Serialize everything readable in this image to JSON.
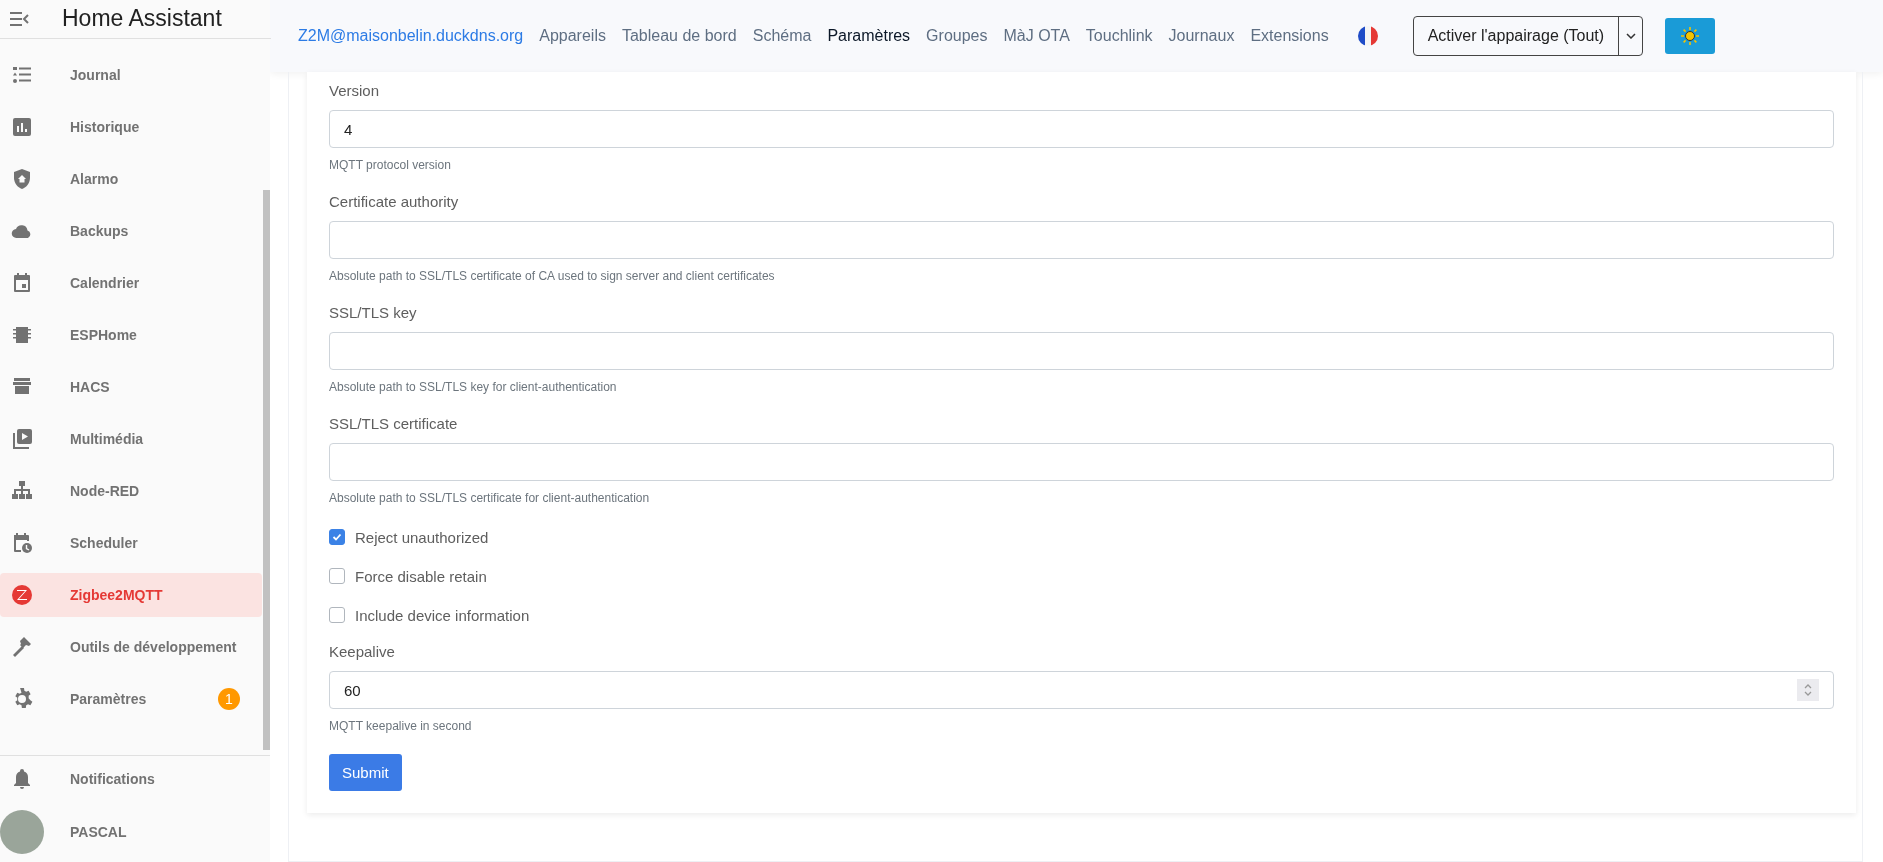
{
  "sidebar": {
    "title": "Home Assistant",
    "items": [
      {
        "label": "Journal",
        "selected": false
      },
      {
        "label": "Historique",
        "selected": false
      },
      {
        "label": "Alarmo",
        "selected": false
      },
      {
        "label": "Backups",
        "selected": false
      },
      {
        "label": "Calendrier",
        "selected": false
      },
      {
        "label": "ESPHome",
        "selected": false
      },
      {
        "label": "HACS",
        "selected": false
      },
      {
        "label": "Multimédia",
        "selected": false
      },
      {
        "label": "Node-RED",
        "selected": false
      },
      {
        "label": "Scheduler",
        "selected": false
      },
      {
        "label": "Zigbee2MQTT",
        "selected": true
      },
      {
        "label": "Outils de développement",
        "selected": false
      },
      {
        "label": "Paramètres",
        "selected": false,
        "badge": "1"
      }
    ],
    "footer": [
      {
        "label": "Notifications",
        "kind": "notifications"
      },
      {
        "label": "PASCAL",
        "kind": "user"
      }
    ]
  },
  "navbar": {
    "brand": "Z2M@maisonbelin.duckdns.org",
    "links": [
      {
        "label": "Appareils",
        "selected": false
      },
      {
        "label": "Tableau de bord",
        "selected": false
      },
      {
        "label": "Schéma",
        "selected": false
      },
      {
        "label": "Paramètres",
        "selected": true
      },
      {
        "label": "Groupes",
        "selected": false
      },
      {
        "label": "MàJ OTA",
        "selected": false
      },
      {
        "label": "Touchlink",
        "selected": false
      },
      {
        "label": "Journaux",
        "selected": false
      },
      {
        "label": "Extensions",
        "selected": false
      }
    ],
    "pairing_button": "Activer l'appairage (Tout)"
  },
  "form": {
    "fields": [
      {
        "kind": "text",
        "label": "Version",
        "value": "4",
        "hint": "MQTT protocol version"
      },
      {
        "kind": "text",
        "label": "Certificate authority",
        "hint": "Absolute path to SSL/TLS certificate of CA used to sign server and client certificates"
      },
      {
        "kind": "text",
        "label": "SSL/TLS key",
        "hint": "Absolute path to SSL/TLS key for client-authentication"
      },
      {
        "kind": "text",
        "label": "SSL/TLS certificate",
        "hint": "Absolute path to SSL/TLS certificate for client-authentication"
      },
      {
        "kind": "checkbox",
        "label": "Reject unauthorized",
        "checked": true
      },
      {
        "kind": "checkbox",
        "label": "Force disable retain",
        "checked": false
      },
      {
        "kind": "checkbox",
        "label": "Include device information",
        "checked": false
      },
      {
        "kind": "number",
        "label": "Keepalive",
        "value": "60",
        "hint": "MQTT keepalive in second"
      }
    ],
    "submit": "Submit"
  }
}
